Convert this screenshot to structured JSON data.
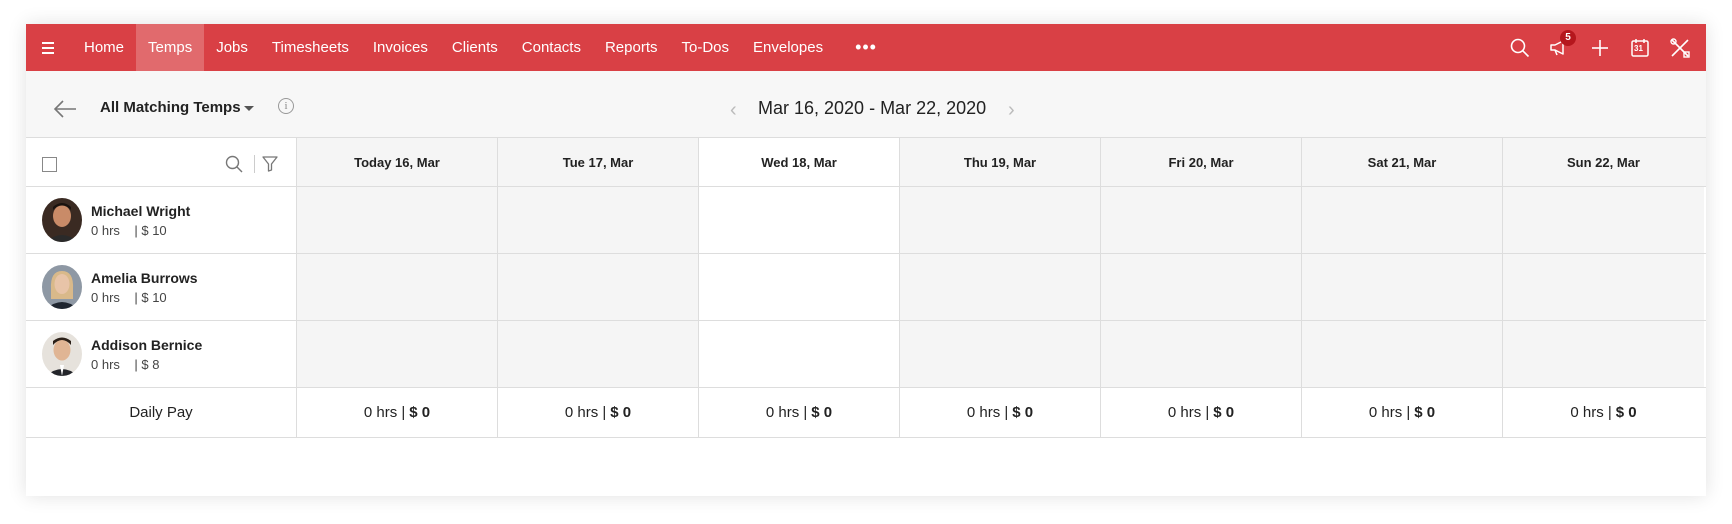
{
  "nav": {
    "items": [
      {
        "label": "Home",
        "active": false
      },
      {
        "label": "Temps",
        "active": true
      },
      {
        "label": "Jobs",
        "active": false
      },
      {
        "label": "Timesheets",
        "active": false
      },
      {
        "label": "Invoices",
        "active": false
      },
      {
        "label": "Clients",
        "active": false
      },
      {
        "label": "Contacts",
        "active": false
      },
      {
        "label": "Reports",
        "active": false
      },
      {
        "label": "To-Dos",
        "active": false
      },
      {
        "label": "Envelopes",
        "active": false
      }
    ],
    "more": "•••",
    "notification_count": "5",
    "calendar_day": "31",
    "brand_color": "#d94045"
  },
  "toolbar": {
    "filter_label": "All Matching Temps",
    "info": "i",
    "date_range": "Mar 16, 2020 - Mar 22, 2020"
  },
  "days": [
    {
      "label": "Today 16, Mar",
      "selected": false
    },
    {
      "label": "Tue 17, Mar",
      "selected": false
    },
    {
      "label": "Wed 18, Mar",
      "selected": true
    },
    {
      "label": "Thu 19, Mar",
      "selected": false
    },
    {
      "label": "Fri 20, Mar",
      "selected": false
    },
    {
      "label": "Sat 21, Mar",
      "selected": false
    },
    {
      "label": "Sun 22, Mar",
      "selected": false
    }
  ],
  "temps": [
    {
      "name": "Michael Wright",
      "hours": "0 hrs",
      "rate": "| $ 10"
    },
    {
      "name": "Amelia Burrows",
      "hours": "0 hrs",
      "rate": "| $ 10"
    },
    {
      "name": "Addison Bernice",
      "hours": "0 hrs",
      "rate": "| $ 8"
    }
  ],
  "footer": {
    "label": "Daily Pay",
    "cells": [
      {
        "hours": "0 hrs |",
        "pay": "$ 0"
      },
      {
        "hours": "0 hrs |",
        "pay": "$ 0"
      },
      {
        "hours": "0 hrs |",
        "pay": "$ 0"
      },
      {
        "hours": "0 hrs |",
        "pay": "$ 0"
      },
      {
        "hours": "0 hrs |",
        "pay": "$ 0"
      },
      {
        "hours": "0 hrs |",
        "pay": "$ 0"
      },
      {
        "hours": "0 hrs |",
        "pay": "$ 0"
      }
    ]
  }
}
